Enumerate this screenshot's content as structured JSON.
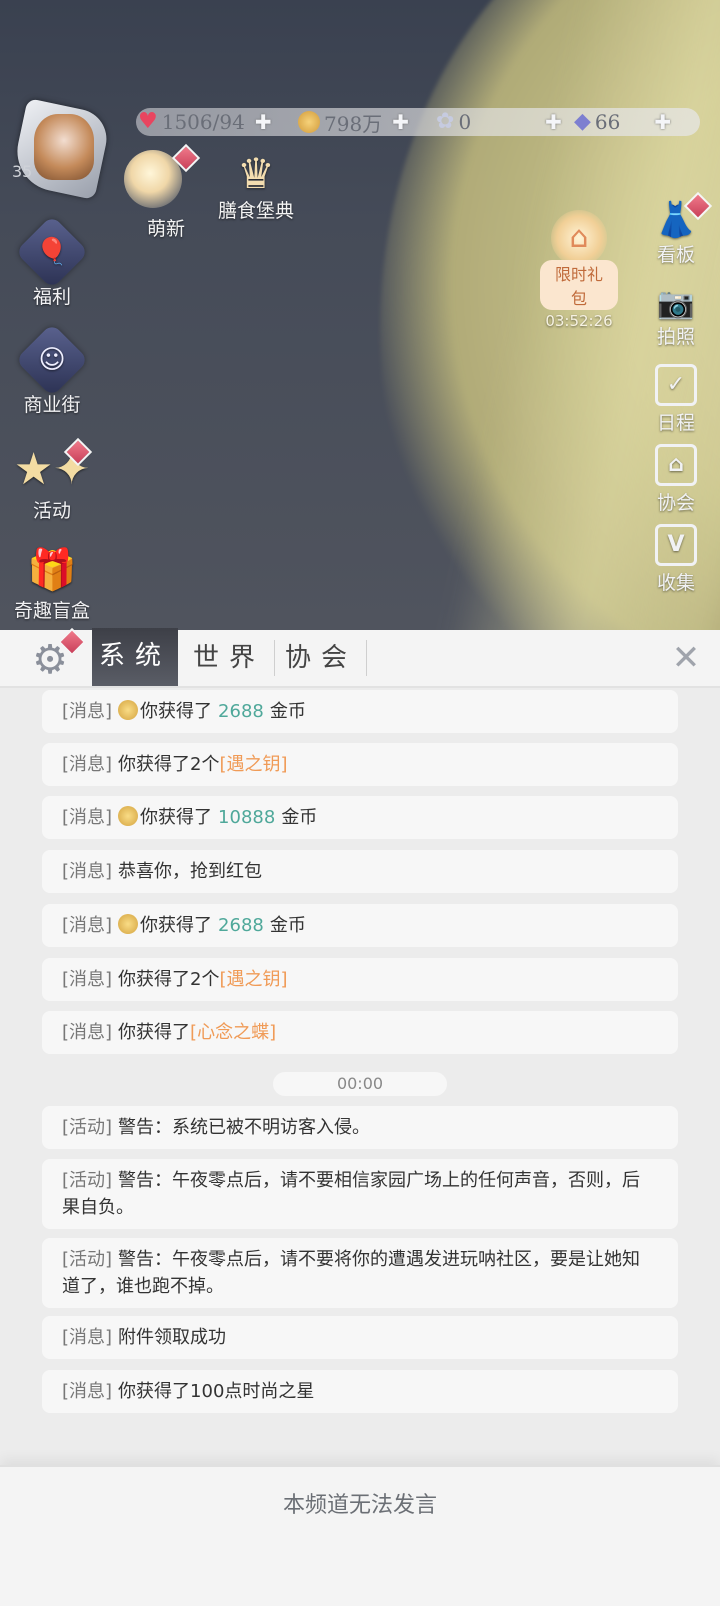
{
  "header": {
    "level": "35",
    "resources": [
      {
        "name": "hearts",
        "icon": "heart-icon",
        "value": "1506/94"
      },
      {
        "name": "coins",
        "icon": "coin-icon",
        "value": "798万"
      },
      {
        "name": "flowers",
        "icon": "flower-icon",
        "value": "0"
      },
      {
        "name": "diamonds",
        "icon": "diamond-icon",
        "value": "66"
      }
    ]
  },
  "top_icons": [
    {
      "name": "新人",
      "label": "萌新"
    },
    {
      "name": "膳食堡典",
      "label": "膳食堡典"
    }
  ],
  "left_icons": [
    {
      "label": "福利"
    },
    {
      "label": "商业街"
    },
    {
      "label": "活动"
    },
    {
      "label": "奇趣盲盒"
    }
  ],
  "gift": {
    "label": "限时礼包",
    "timer": "03:52:26"
  },
  "right_icons": [
    {
      "label": "看板",
      "icon": "dress-icon"
    },
    {
      "label": "拍照",
      "icon": "camera-icon"
    },
    {
      "label": "日程",
      "icon": "calendar-icon"
    },
    {
      "label": "协会",
      "icon": "guild-icon"
    },
    {
      "label": "收集",
      "icon": "collect-icon"
    }
  ],
  "chat": {
    "tabs": [
      "系统",
      "世界",
      "协会"
    ],
    "active_tab": "系统",
    "messages": [
      {
        "tag": "[消息]",
        "pre": "你获得了",
        "num": "2688",
        "post": "金币",
        "coin": true
      },
      {
        "tag": "[消息]",
        "pre": "你获得了2个",
        "item": "[遇之钥]"
      },
      {
        "tag": "[消息]",
        "pre": "你获得了",
        "num": "10888",
        "post": "金币",
        "coin": true
      },
      {
        "tag": "[消息]",
        "pre": "恭喜你，抢到红包"
      },
      {
        "tag": "[消息]",
        "pre": "你获得了",
        "num": "2688",
        "post": "金币",
        "coin": true
      },
      {
        "tag": "[消息]",
        "pre": "你获得了2个",
        "item": "[遇之钥]"
      },
      {
        "tag": "[消息]",
        "pre": "你获得了",
        "item": "[心念之蝶]"
      }
    ],
    "time_divider": "00:00",
    "messages2": [
      {
        "tag": "[活动]",
        "text": "警告：系统已被不明访客入侵。"
      },
      {
        "tag": "[活动]",
        "text": "警告：午夜零点后，请不要相信家园广场上的任何声音，否则，后果自负。"
      },
      {
        "tag": "[活动]",
        "text": "警告：午夜零点后，请不要将你的遭遇发进玩呐社区，要是让她知道了，谁也跑不掉。"
      },
      {
        "tag": "[消息]",
        "text": "附件领取成功"
      },
      {
        "tag": "[消息]",
        "text": "你获得了100点时尚之星"
      }
    ],
    "footer": "本频道无法发言"
  },
  "colors": {
    "accent_green": "#4fa89a",
    "item_orange": "#f09b57",
    "tab_active": "#45474f"
  }
}
